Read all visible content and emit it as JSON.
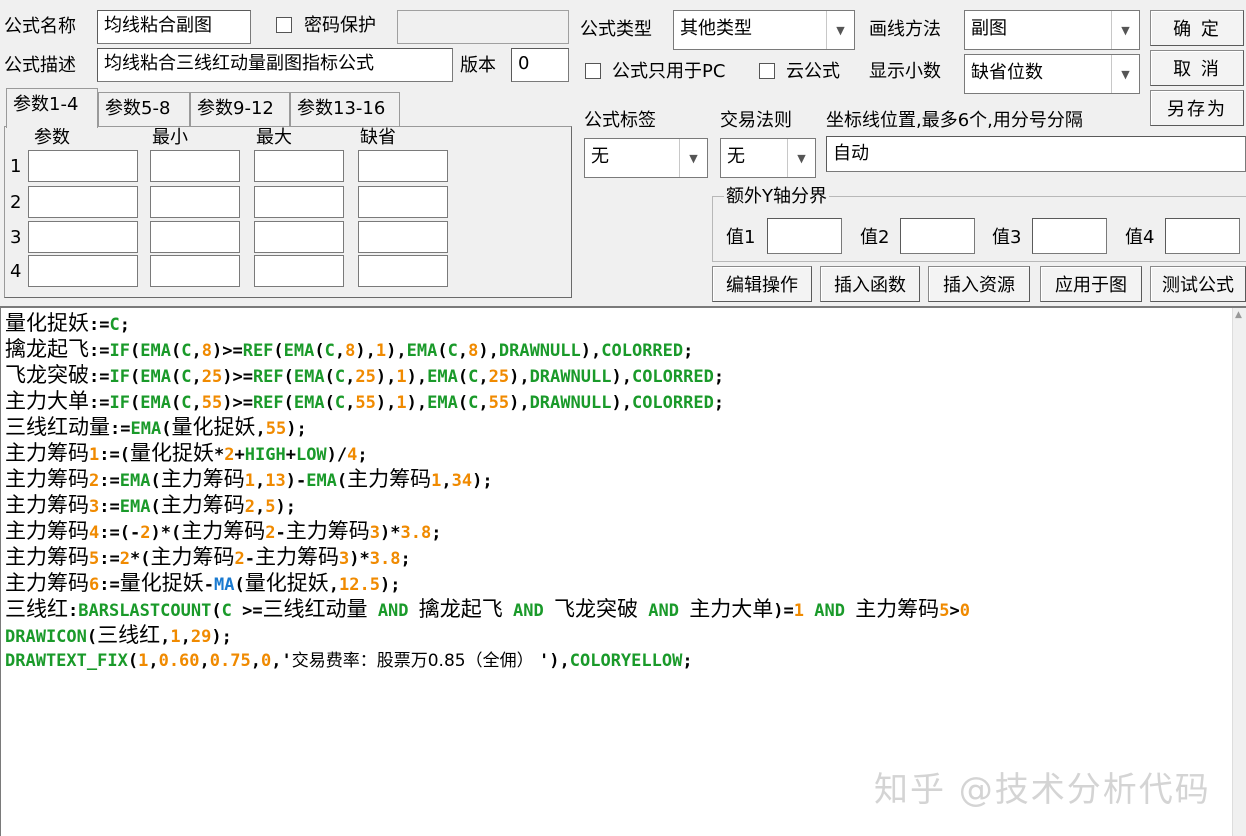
{
  "header": {
    "name_label": "公式名称",
    "name_value": "均线粘合副图",
    "password_label": "密码保护",
    "desc_label": "公式描述",
    "desc_value": "均线粘合三线红动量副图指标公式",
    "version_label": "版本",
    "version_value": "0",
    "type_label": "公式类型",
    "type_value": "其他类型",
    "draw_label": "画线方法",
    "draw_value": "副图",
    "pc_only_label": "公式只用于PC",
    "cloud_label": "云公式",
    "decimals_label": "显示小数",
    "decimals_value": "缺省位数"
  },
  "buttons": {
    "ok": "确 定",
    "cancel": "取 消",
    "save_as": "另存为",
    "edit_ops": "编辑操作",
    "insert_func": "插入函数",
    "insert_res": "插入资源",
    "apply": "应用于图",
    "test": "测试公式"
  },
  "param_tabs": [
    "参数1-4",
    "参数5-8",
    "参数9-12",
    "参数13-16"
  ],
  "param_headers": [
    "参数",
    "最小",
    "最大",
    "缺省"
  ],
  "param_rows": [
    "1",
    "2",
    "3",
    "4"
  ],
  "formula_tag_label": "公式标签",
  "formula_tag_value": "无",
  "trade_rule_label": "交易法则",
  "trade_rule_value": "无",
  "axis_label": "坐标线位置,最多6个,用分号分隔",
  "axis_value": "自动",
  "extra_y_label": "额外Y轴分界",
  "extra_y": [
    "值1",
    "值2",
    "值3",
    "值4"
  ],
  "code_lines": [
    "量化捉妖:=C;",
    "擒龙起飞:=IF(EMA(C,8)>=REF(EMA(C,8),1),EMA(C,8),DRAWNULL),COLORRED;",
    "飞龙突破:=IF(EMA(C,25)>=REF(EMA(C,25),1),EMA(C,25),DRAWNULL),COLORRED;",
    "主力大单:=IF(EMA(C,55)>=REF(EMA(C,55),1),EMA(C,55),DRAWNULL),COLORRED;",
    "三线红动量:=EMA(量化捉妖,55);",
    "主力筹码1:=(量化捉妖*2+HIGH+LOW)/4;",
    "主力筹码2:=EMA(主力筹码1,13)-EMA(主力筹码1,34);",
    "主力筹码3:=EMA(主力筹码2,5);",
    "主力筹码4:=(-2)*(主力筹码2-主力筹码3)*3.8;",
    "主力筹码5:=2*(主力筹码2-主力筹码3)*3.8;",
    "主力筹码6:=量化捉妖-MA(量化捉妖,12.5);",
    "三线红:BARSLASTCOUNT(C >=三线红动量 AND 擒龙起飞 AND 飞龙突破 AND 主力大单)=1 AND 主力筹码5>0",
    "DRAWICON(三线红,1,29);",
    "DRAWTEXT_FIX(1,0.60,0.75,0,'交易费率：股票万0.85（全佣） '),COLORYELLOW;"
  ],
  "watermark": "知乎 @技术分析代码",
  "colors": {
    "keyword": "#1a9a2a",
    "number": "#f08a00",
    "ma": "#1a7ad0",
    "panel_bg": "#f0f0f0",
    "editor_bg": "#ffffff"
  }
}
